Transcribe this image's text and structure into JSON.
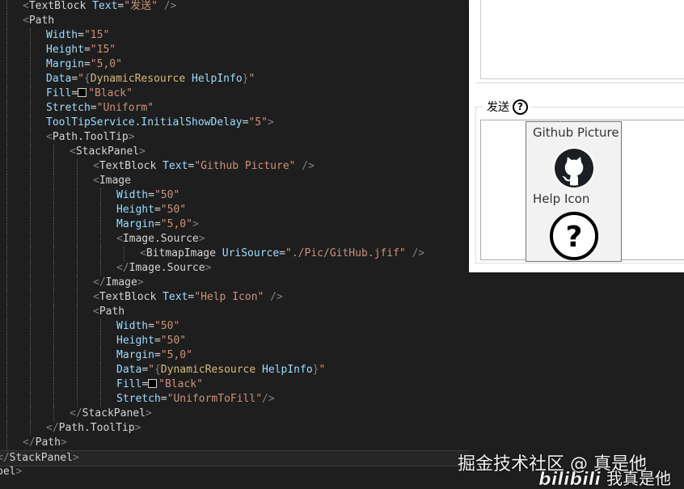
{
  "editor": {
    "lines": [
      {
        "indent": 1,
        "parts": [
          [
            "punct",
            "<"
          ],
          [
            "tag",
            "TextBlock"
          ],
          [
            "attr",
            " Text"
          ],
          [
            "eq",
            "="
          ],
          [
            "val",
            "\"发送\""
          ],
          [
            "punct",
            " />"
          ]
        ]
      },
      {
        "indent": 1,
        "parts": [
          [
            "punct",
            "<"
          ],
          [
            "tag",
            "Path"
          ]
        ]
      },
      {
        "indent": 2,
        "parts": [
          [
            "attr",
            "Width"
          ],
          [
            "eq",
            "="
          ],
          [
            "val",
            "\"15\""
          ]
        ]
      },
      {
        "indent": 2,
        "parts": [
          [
            "attr",
            "Height"
          ],
          [
            "eq",
            "="
          ],
          [
            "val",
            "\"15\""
          ]
        ]
      },
      {
        "indent": 2,
        "parts": [
          [
            "attr",
            "Margin"
          ],
          [
            "eq",
            "="
          ],
          [
            "val",
            "\"5,0\""
          ]
        ]
      },
      {
        "indent": 2,
        "parts": [
          [
            "attr",
            "Data"
          ],
          [
            "eq",
            "="
          ],
          [
            "val",
            "\""
          ],
          [
            "ext",
            "{"
          ],
          [
            "extname",
            "DynamicResource"
          ],
          [
            "attr",
            " HelpInfo"
          ],
          [
            "ext",
            "}"
          ],
          [
            "val",
            "\""
          ]
        ]
      },
      {
        "indent": 2,
        "parts": [
          [
            "attr",
            "Fill"
          ],
          [
            "eq",
            "="
          ],
          [
            "swatch",
            ""
          ],
          [
            "val",
            "\"Black\""
          ]
        ]
      },
      {
        "indent": 2,
        "parts": [
          [
            "attr",
            "Stretch"
          ],
          [
            "eq",
            "="
          ],
          [
            "val",
            "\"Uniform\""
          ]
        ]
      },
      {
        "indent": 2,
        "parts": [
          [
            "attr",
            "ToolTipService.InitialShowDelay"
          ],
          [
            "eq",
            "="
          ],
          [
            "val",
            "\"5\""
          ],
          [
            "punct",
            ">"
          ]
        ]
      },
      {
        "indent": 2,
        "parts": [
          [
            "punct",
            "<"
          ],
          [
            "tag",
            "Path.ToolTip"
          ],
          [
            "punct",
            ">"
          ]
        ]
      },
      {
        "indent": 3,
        "parts": [
          [
            "punct",
            "<"
          ],
          [
            "tag",
            "StackPanel"
          ],
          [
            "punct",
            ">"
          ]
        ]
      },
      {
        "indent": 4,
        "parts": [
          [
            "punct",
            "<"
          ],
          [
            "tag",
            "TextBlock"
          ],
          [
            "attr",
            " Text"
          ],
          [
            "eq",
            "="
          ],
          [
            "val",
            "\"Github Picture\""
          ],
          [
            "punct",
            " />"
          ]
        ]
      },
      {
        "indent": 4,
        "parts": [
          [
            "punct",
            "<"
          ],
          [
            "tag",
            "Image"
          ]
        ]
      },
      {
        "indent": 5,
        "parts": [
          [
            "attr",
            "Width"
          ],
          [
            "eq",
            "="
          ],
          [
            "val",
            "\"50\""
          ]
        ]
      },
      {
        "indent": 5,
        "parts": [
          [
            "attr",
            "Height"
          ],
          [
            "eq",
            "="
          ],
          [
            "val",
            "\"50\""
          ]
        ]
      },
      {
        "indent": 5,
        "parts": [
          [
            "attr",
            "Margin"
          ],
          [
            "eq",
            "="
          ],
          [
            "val",
            "\"5,0\""
          ],
          [
            "punct",
            ">"
          ]
        ]
      },
      {
        "indent": 5,
        "parts": [
          [
            "punct",
            "<"
          ],
          [
            "tag",
            "Image.Source"
          ],
          [
            "punct",
            ">"
          ]
        ]
      },
      {
        "indent": 6,
        "parts": [
          [
            "punct",
            "<"
          ],
          [
            "tag",
            "BitmapImage"
          ],
          [
            "attr",
            " UriSource"
          ],
          [
            "eq",
            "="
          ],
          [
            "val",
            "\"./Pic/GitHub.jfif\""
          ],
          [
            "punct",
            " />"
          ]
        ]
      },
      {
        "indent": 5,
        "parts": [
          [
            "punct",
            "</"
          ],
          [
            "tag",
            "Image.Source"
          ],
          [
            "punct",
            ">"
          ]
        ]
      },
      {
        "indent": 4,
        "parts": [
          [
            "punct",
            "</"
          ],
          [
            "tag",
            "Image"
          ],
          [
            "punct",
            ">"
          ]
        ]
      },
      {
        "indent": 4,
        "parts": [
          [
            "punct",
            "<"
          ],
          [
            "tag",
            "TextBlock"
          ],
          [
            "attr",
            " Text"
          ],
          [
            "eq",
            "="
          ],
          [
            "val",
            "\"Help Icon\""
          ],
          [
            "punct",
            " />"
          ]
        ]
      },
      {
        "indent": 4,
        "parts": [
          [
            "punct",
            "<"
          ],
          [
            "tag",
            "Path"
          ]
        ]
      },
      {
        "indent": 5,
        "parts": [
          [
            "attr",
            "Width"
          ],
          [
            "eq",
            "="
          ],
          [
            "val",
            "\"50\""
          ]
        ]
      },
      {
        "indent": 5,
        "parts": [
          [
            "attr",
            "Height"
          ],
          [
            "eq",
            "="
          ],
          [
            "val",
            "\"50\""
          ]
        ]
      },
      {
        "indent": 5,
        "parts": [
          [
            "attr",
            "Margin"
          ],
          [
            "eq",
            "="
          ],
          [
            "val",
            "\"5,0\""
          ]
        ]
      },
      {
        "indent": 5,
        "parts": [
          [
            "attr",
            "Data"
          ],
          [
            "eq",
            "="
          ],
          [
            "val",
            "\""
          ],
          [
            "ext",
            "{"
          ],
          [
            "extname",
            "DynamicResource"
          ],
          [
            "attr",
            " HelpInfo"
          ],
          [
            "ext",
            "}"
          ],
          [
            "val",
            "\""
          ]
        ]
      },
      {
        "indent": 5,
        "parts": [
          [
            "attr",
            "Fill"
          ],
          [
            "eq",
            "="
          ],
          [
            "swatch",
            ""
          ],
          [
            "val",
            "\"Black\""
          ]
        ]
      },
      {
        "indent": 5,
        "parts": [
          [
            "attr",
            "Stretch"
          ],
          [
            "eq",
            "="
          ],
          [
            "val",
            "\"UniformToFill\""
          ],
          [
            "punct",
            "/>"
          ]
        ]
      },
      {
        "indent": 3,
        "parts": [
          [
            "punct",
            "</"
          ],
          [
            "tag",
            "StackPanel"
          ],
          [
            "punct",
            ">"
          ]
        ]
      },
      {
        "indent": 2,
        "parts": [
          [
            "punct",
            "</"
          ],
          [
            "tag",
            "Path.ToolTip"
          ],
          [
            "punct",
            ">"
          ]
        ]
      },
      {
        "indent": 1,
        "parts": [
          [
            "punct",
            "</"
          ],
          [
            "tag",
            "Path"
          ],
          [
            "punct",
            ">"
          ]
        ]
      },
      {
        "indent": 0,
        "parts": [
          [
            "punct",
            "</"
          ],
          [
            "tag",
            "StackPanel"
          ],
          [
            "punct",
            ">"
          ]
        ]
      },
      {
        "indent": 0,
        "parts": [
          [
            "tag",
            "bel"
          ],
          [
            "punct",
            ">"
          ]
        ]
      }
    ]
  },
  "preview": {
    "group_header": "发送",
    "help_glyph": "?",
    "tooltip": {
      "title_1": "Github Picture",
      "title_2": "Help Icon",
      "help_glyph": "?"
    }
  },
  "watermark": {
    "site_text": "掘金技术社区 @ 真是他",
    "logo_text": "bilibili",
    "user_text": "我真是他"
  },
  "colors": {
    "editor_bg": "#1e1e1e",
    "attr": "#9cdcfe",
    "value": "#ce9178",
    "markup_ext": "#d7ba7d"
  }
}
